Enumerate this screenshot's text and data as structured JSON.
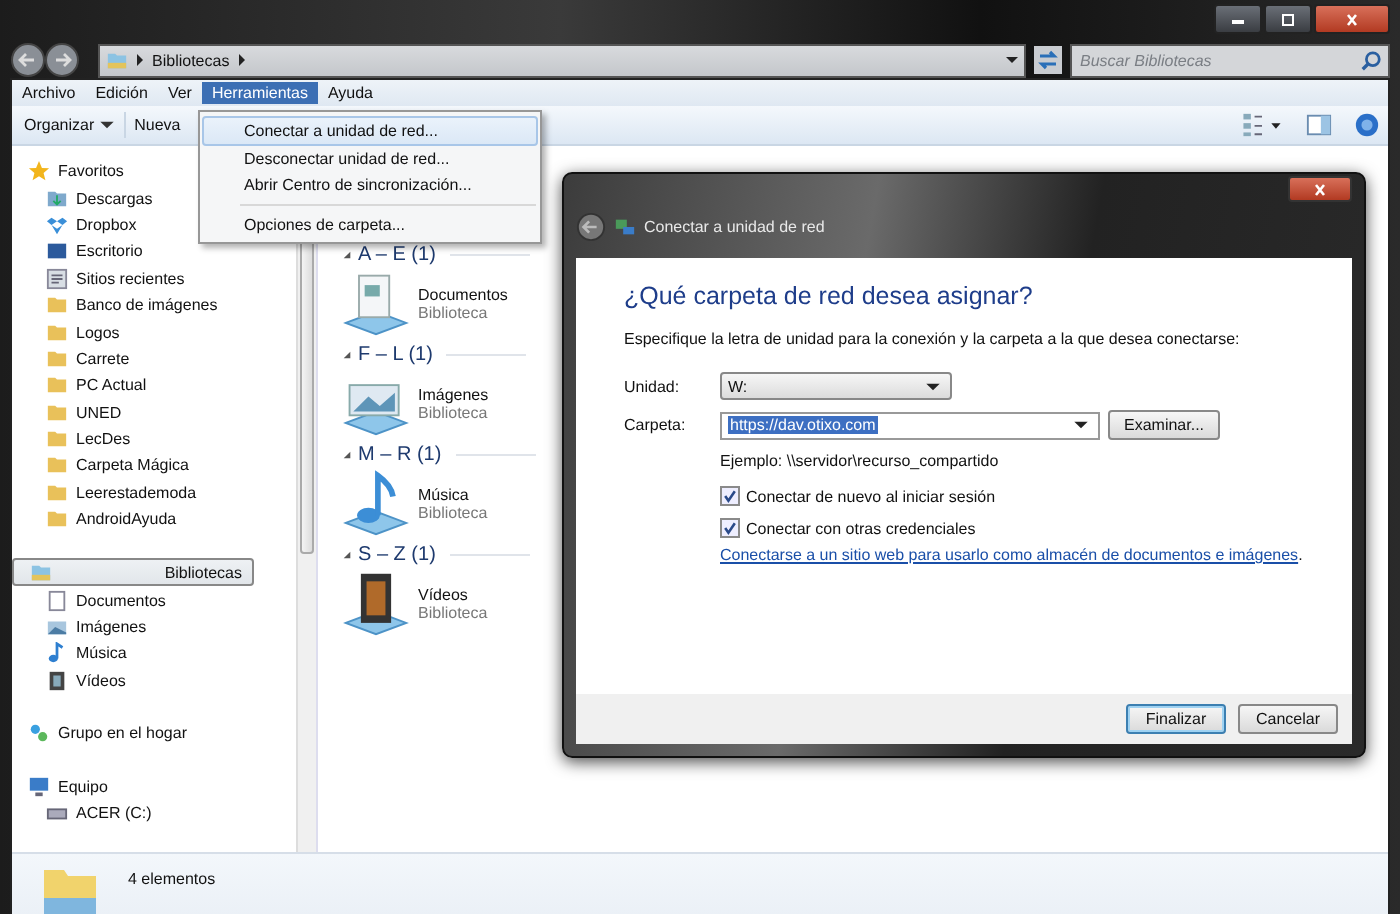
{
  "window": {
    "address": [
      "Bibliotecas"
    ],
    "search_placeholder": "Buscar Bibliotecas"
  },
  "menu_bar": [
    {
      "label": "Archivo",
      "selected": false
    },
    {
      "label": "Edición",
      "selected": false
    },
    {
      "label": "Ver",
      "selected": false
    },
    {
      "label": "Herramientas",
      "selected": true
    },
    {
      "label": "Ayuda",
      "selected": false
    }
  ],
  "open_menu": [
    {
      "label": "Conectar a unidad de red...",
      "selected": true,
      "separator_before": false
    },
    {
      "label": "Desconectar unidad de red...",
      "selected": false,
      "separator_before": false
    },
    {
      "label": "Abrir Centro de sincronización...",
      "selected": false,
      "separator_before": false
    },
    {
      "label": "Opciones de carpeta...",
      "selected": false,
      "separator_before": true
    }
  ],
  "toolbar": [
    {
      "label": "Organizar",
      "dropdown": true
    },
    {
      "label": "Nueva",
      "dropdown": false
    }
  ],
  "sidebar": [
    {
      "label": "Favoritos",
      "kind": "star",
      "selected": false,
      "children": [
        {
          "label": "Descargas",
          "kind": "download"
        },
        {
          "label": "Dropbox",
          "kind": "dropbox"
        },
        {
          "label": "Escritorio",
          "kind": "desktop"
        },
        {
          "label": "Sitios recientes",
          "kind": "recent"
        },
        {
          "label": "Banco de imágenes",
          "kind": "folder"
        },
        {
          "label": "Logos",
          "kind": "folder"
        },
        {
          "label": "Carrete",
          "kind": "folder"
        },
        {
          "label": "PC Actual",
          "kind": "folder"
        },
        {
          "label": "UNED",
          "kind": "folder"
        },
        {
          "label": "LecDes",
          "kind": "folder"
        },
        {
          "label": "Carpeta Mágica",
          "kind": "folder"
        },
        {
          "label": "Leerestademoda",
          "kind": "folder"
        },
        {
          "label": "AndroidAyuda",
          "kind": "folder"
        }
      ]
    },
    {
      "label": "Bibliotecas",
      "kind": "library",
      "selected": true,
      "children": [
        {
          "label": "Documentos",
          "kind": "documents"
        },
        {
          "label": "Imágenes",
          "kind": "pictures"
        },
        {
          "label": "Música",
          "kind": "music"
        },
        {
          "label": "Vídeos",
          "kind": "videos"
        }
      ]
    },
    {
      "label": "Grupo en el hogar",
      "kind": "homegroup",
      "selected": false
    },
    {
      "label": "Equipo",
      "kind": "computer",
      "selected": false,
      "children": [
        {
          "label": "ACER (C:)",
          "kind": "drive"
        }
      ]
    }
  ],
  "groups": [
    {
      "heading": "A – E (1)",
      "items": [
        {
          "name": "Documentos",
          "type": "Biblioteca",
          "kind": "documents"
        }
      ]
    },
    {
      "heading": "F – L (1)",
      "items": [
        {
          "name": "Imágenes",
          "type": "Biblioteca",
          "kind": "pictures"
        }
      ]
    },
    {
      "heading": "M – R (1)",
      "items": [
        {
          "name": "Música",
          "type": "Biblioteca",
          "kind": "music"
        }
      ]
    },
    {
      "heading": "S – Z (1)",
      "items": [
        {
          "name": "Vídeos",
          "type": "Biblioteca",
          "kind": "videos"
        }
      ]
    }
  ],
  "status_bar": {
    "count": "4 elementos"
  },
  "dialog": {
    "title": "Conectar a unidad de red",
    "heading": "¿Qué carpeta de red desea asignar?",
    "instructions": "Especifique la letra de unidad para la conexión y la carpeta a la que desea conectarse:",
    "drive_label": "Unidad:",
    "drive_value": "W:",
    "folder_label": "Carpeta:",
    "folder_value": "https://dav.otixo.com",
    "folder_value_selected": true,
    "browse_button": "Examinar...",
    "example": "Ejemplo: \\\\servidor\\recurso_compartido",
    "options": [
      {
        "label": "Conectar de nuevo al iniciar sesión",
        "checked": true
      },
      {
        "label": "Conectar con otras credenciales",
        "checked": true
      }
    ],
    "link": "Conectarse a un sitio web para usarlo como almacén de documentos e imágenes",
    "link_suffix": ".",
    "buttons": [
      {
        "label": "Finalizar",
        "default": true
      },
      {
        "label": "Cancelar",
        "default": false
      }
    ]
  }
}
